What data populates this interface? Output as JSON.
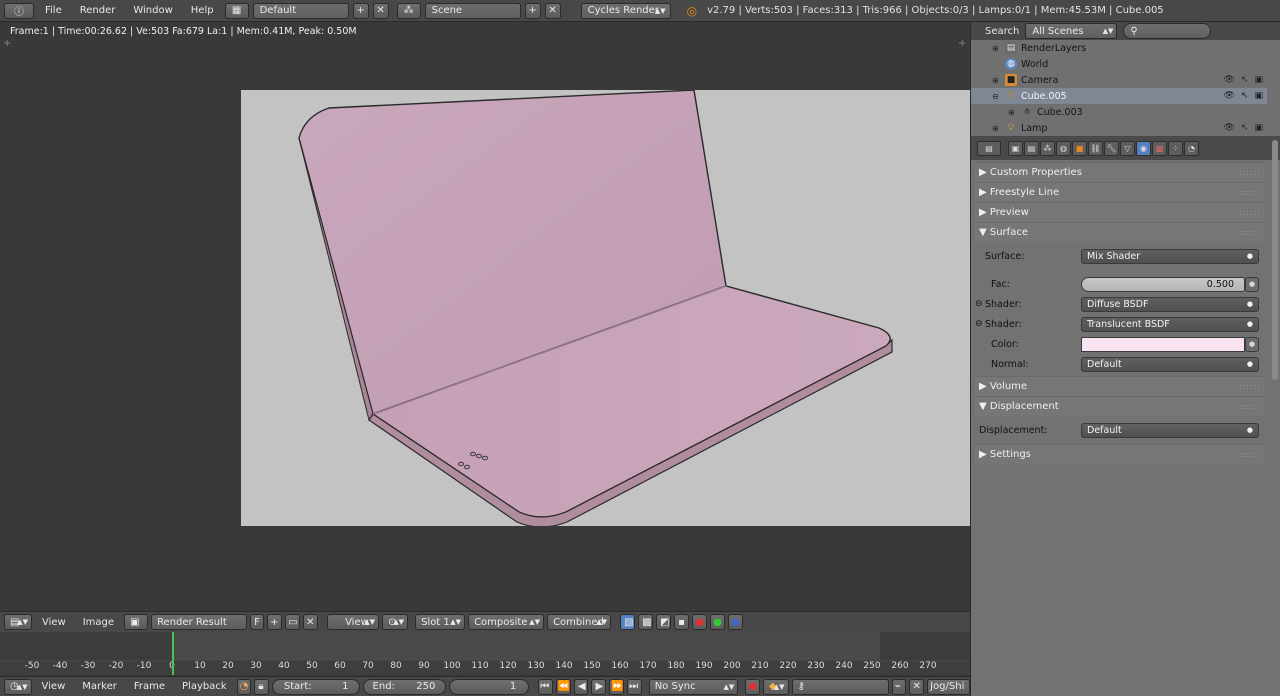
{
  "topbar": {
    "menus": [
      "File",
      "Render",
      "Window",
      "Help"
    ],
    "layout": "Default",
    "scene": "Scene",
    "engine": "Cycles Render",
    "stats": "v2.79 | Verts:503 | Faces:313 | Tris:966 | Objects:0/3 | Lamps:0/1 | Mem:45.53M | Cube.005"
  },
  "viewport": {
    "info": "Frame:1 | Time:00:26.62 | Ve:503 Fa:679 La:1 | Mem:0.41M, Peak: 0.50M",
    "colors": {
      "background": "#c3c3c3",
      "object": "#c8a2b8",
      "outline": "#2a2a2a"
    }
  },
  "image_header": {
    "view": "View",
    "image": "Image",
    "image_name": "Render Result",
    "fake_user": "F",
    "view_mode": "View",
    "slot": "Slot 1",
    "pass_layer": "Composite",
    "pass": "Combined"
  },
  "timeline": {
    "ticks": [
      "-50",
      "-40",
      "-30",
      "-20",
      "-10",
      "0",
      "10",
      "20",
      "30",
      "40",
      "50",
      "60",
      "70",
      "80",
      "90",
      "100",
      "110",
      "120",
      "130",
      "140",
      "150",
      "160",
      "170",
      "180",
      "190",
      "200",
      "210",
      "220",
      "230",
      "240",
      "250",
      "260",
      "270"
    ],
    "view": "View",
    "marker": "Marker",
    "frame": "Frame",
    "playback": "Playback",
    "start_label": "Start:",
    "start": "1",
    "end_label": "End:",
    "end": "250",
    "current": "1",
    "sync": "No Sync",
    "keying": "Jog/Shi"
  },
  "outliner": {
    "search_label": "Search",
    "filter": "All Scenes",
    "rows": [
      {
        "label": "RenderLayers",
        "icon": "render-layers-icon"
      },
      {
        "label": "World",
        "icon": "world-icon"
      },
      {
        "label": "Camera",
        "icon": "camera-icon"
      },
      {
        "label": "Cube.005",
        "icon": "mesh-object-icon"
      },
      {
        "label": "Cube.003",
        "icon": "mesh-data-icon"
      },
      {
        "label": "Lamp",
        "icon": "lamp-icon"
      }
    ]
  },
  "properties": {
    "panels": {
      "custom": "Custom Properties",
      "freestyle": "Freestyle Line",
      "preview": "Preview",
      "surface": "Surface",
      "volume": "Volume",
      "displacement": "Displacement",
      "settings": "Settings"
    },
    "surface_label": "Surface:",
    "surface_value": "Mix Shader",
    "fac_label": "Fac:",
    "fac_value": "0.500",
    "shader1_label": "Shader:",
    "shader1_value": "Diffuse BSDF",
    "shader2_label": "Shader:",
    "shader2_value": "Translucent BSDF",
    "color_label": "Color:",
    "color_value": "#f9e3f3",
    "normal_label": "Normal:",
    "normal_value": "Default",
    "displacement_label": "Displacement:",
    "displacement_value": "Default"
  }
}
